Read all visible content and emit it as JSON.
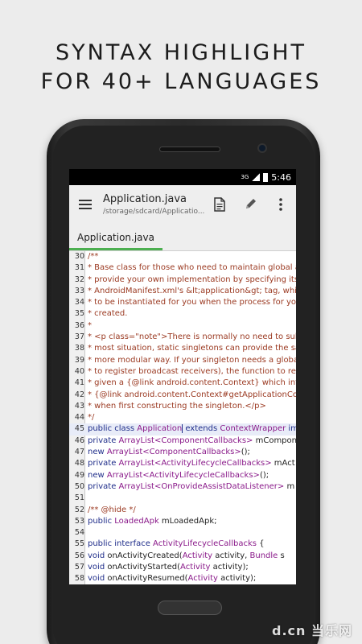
{
  "headline": {
    "line1": "SYNTAX HIGHLIGHT",
    "line2": "FOR 40+ LANGUAGES"
  },
  "status_bar": {
    "network": "3G",
    "time": "5:46"
  },
  "toolbar": {
    "title": "Application.java",
    "path": "/storage/sdcard/Applicatio..."
  },
  "tabs": [
    {
      "label": "Application.java",
      "active": true
    }
  ],
  "colors": {
    "accent": "#4caf50",
    "comment": "#9b3a22",
    "keyword": "#1f2d8a",
    "type": "#8a1a8a"
  },
  "code_lines": [
    {
      "num": "30",
      "segments": [
        [
          "comment",
          "/**"
        ]
      ]
    },
    {
      "num": "31",
      "segments": [
        [
          "comment",
          " * Base class for those who need to maintain global a"
        ]
      ]
    },
    {
      "num": "32",
      "segments": [
        [
          "comment",
          " * provide your own implementation by specifying its"
        ]
      ]
    },
    {
      "num": "33",
      "segments": [
        [
          "comment",
          " * AndroidManifest.xml's &lt;application&gt; tag, whic"
        ]
      ]
    },
    {
      "num": "34",
      "segments": [
        [
          "comment",
          " * to be instantiated for you when the process for you"
        ]
      ]
    },
    {
      "num": "35",
      "segments": [
        [
          "comment",
          " * created."
        ]
      ]
    },
    {
      "num": "36",
      "segments": [
        [
          "comment",
          " *"
        ]
      ]
    },
    {
      "num": "37",
      "segments": [
        [
          "comment",
          " * <p class=\"note\">There is normally no need to subc"
        ]
      ]
    },
    {
      "num": "38",
      "segments": [
        [
          "comment",
          " * most situation, static singletons can provide the sa"
        ]
      ]
    },
    {
      "num": "39",
      "segments": [
        [
          "comment",
          " * more modular way.  If your singleton needs a globa"
        ]
      ]
    },
    {
      "num": "40",
      "segments": [
        [
          "comment",
          " * to register broadcast receivers), the function to retr"
        ]
      ]
    },
    {
      "num": "41",
      "segments": [
        [
          "comment",
          " * given a {@link android.content.Context} which inter"
        ]
      ]
    },
    {
      "num": "42",
      "segments": [
        [
          "comment",
          " * {@link android.content.Context#getApplicationCon"
        ]
      ]
    },
    {
      "num": "43",
      "segments": [
        [
          "comment",
          " * when first constructing the singleton.</p>"
        ]
      ]
    },
    {
      "num": "44",
      "segments": [
        [
          "comment",
          " */"
        ]
      ]
    },
    {
      "num": "45",
      "highlight": true,
      "segments": [
        [
          "kw",
          "public class "
        ],
        [
          "type",
          "Application"
        ],
        [
          "cursor",
          ""
        ],
        [
          "kw",
          " extends "
        ],
        [
          "type",
          "ContextWrapper"
        ],
        [
          "kw",
          " imp"
        ]
      ]
    },
    {
      "num": "46",
      "segments": [
        [
          "kw",
          "    private "
        ],
        [
          "type",
          "ArrayList<ComponentCallbacks>"
        ],
        [
          "plain",
          " mCompon"
        ]
      ]
    },
    {
      "num": "47",
      "segments": [
        [
          "kw",
          "            new "
        ],
        [
          "type",
          "ArrayList<ComponentCallbacks>"
        ],
        [
          "plain",
          "();"
        ]
      ]
    },
    {
      "num": "48",
      "segments": [
        [
          "kw",
          "    private "
        ],
        [
          "type",
          "ArrayList<ActivityLifecycleCallbacks>"
        ],
        [
          "plain",
          " mAct"
        ]
      ]
    },
    {
      "num": "49",
      "segments": [
        [
          "kw",
          "            new "
        ],
        [
          "type",
          "ArrayList<ActivityLifecycleCallbacks>"
        ],
        [
          "plain",
          "();"
        ]
      ]
    },
    {
      "num": "50",
      "segments": [
        [
          "kw",
          "    private "
        ],
        [
          "type",
          "ArrayList<OnProvideAssistDataListener>"
        ],
        [
          "plain",
          " m"
        ]
      ]
    },
    {
      "num": "51",
      "segments": [
        [
          "plain",
          ""
        ]
      ]
    },
    {
      "num": "52",
      "segments": [
        [
          "comment",
          "    /** @hide */"
        ]
      ]
    },
    {
      "num": "53",
      "segments": [
        [
          "kw",
          "    public "
        ],
        [
          "type",
          "LoadedApk"
        ],
        [
          "plain",
          " mLoadedApk;"
        ]
      ]
    },
    {
      "num": "54",
      "segments": [
        [
          "plain",
          ""
        ]
      ]
    },
    {
      "num": "55",
      "segments": [
        [
          "kw",
          "    public interface "
        ],
        [
          "type",
          "ActivityLifecycleCallbacks"
        ],
        [
          "plain",
          " {"
        ]
      ]
    },
    {
      "num": "56",
      "segments": [
        [
          "kw",
          "        void "
        ],
        [
          "plain",
          "onActivityCreated("
        ],
        [
          "type",
          "Activity"
        ],
        [
          "plain",
          " activity, "
        ],
        [
          "type",
          "Bundle"
        ],
        [
          "plain",
          " s"
        ]
      ]
    },
    {
      "num": "57",
      "segments": [
        [
          "kw",
          "        void "
        ],
        [
          "plain",
          "onActivityStarted("
        ],
        [
          "type",
          "Activity"
        ],
        [
          "plain",
          " activity);"
        ]
      ]
    },
    {
      "num": "58",
      "segments": [
        [
          "kw",
          "        void "
        ],
        [
          "plain",
          "onActivityResumed("
        ],
        [
          "type",
          "Activity"
        ],
        [
          "plain",
          " activity);"
        ]
      ]
    }
  ],
  "watermark": "d.cn 当乐网"
}
